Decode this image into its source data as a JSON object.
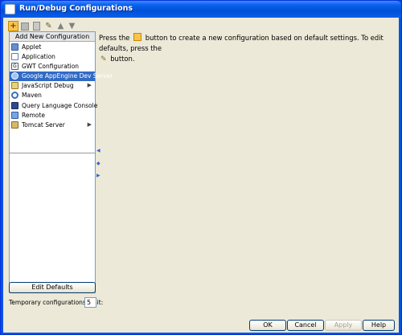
{
  "window": {
    "title": "Run/Debug Configurations"
  },
  "toolbar": {
    "add_icon": "add-icon",
    "remove_icon": "remove-icon",
    "copy_icon": "copy-icon",
    "edit_defaults_icon": "wrench-icon",
    "up_icon": "arrow-up-icon",
    "down_icon": "arrow-down-icon"
  },
  "popup": {
    "header": "Add New Configuration",
    "items": [
      {
        "label": "Applet",
        "icon": "applet-icon",
        "submenu": false
      },
      {
        "label": "Application",
        "icon": "application-icon",
        "submenu": false
      },
      {
        "label": "GWT Configuration",
        "icon": "gwt-icon",
        "submenu": false
      },
      {
        "label": "Google AppEngine Dev Server",
        "icon": "appengine-icon",
        "submenu": false,
        "selected": true
      },
      {
        "label": "JavaScript Debug",
        "icon": "javascript-debug-icon",
        "submenu": true
      },
      {
        "label": "Maven",
        "icon": "maven-icon",
        "submenu": false
      },
      {
        "label": "Query Language Console",
        "icon": "query-console-icon",
        "submenu": false
      },
      {
        "label": "Remote",
        "icon": "remote-icon",
        "submenu": false
      },
      {
        "label": "Tomcat Server",
        "icon": "tomcat-icon",
        "submenu": true
      }
    ]
  },
  "message": {
    "part1": "Press the",
    "part2": "button to create a new configuration based on default settings.  To edit defaults, press the",
    "part3": "button."
  },
  "left": {
    "edit_defaults_label": "Edit Defaults",
    "temp_limit_label": "Temporary configurations limit:",
    "temp_limit_value": "5"
  },
  "buttons": {
    "ok": "OK",
    "cancel": "Cancel",
    "apply": "Apply",
    "help": "Help"
  },
  "colors": {
    "titlebar": "#0054e3",
    "selection": "#316ac5",
    "dialog_bg": "#ece9d8"
  }
}
